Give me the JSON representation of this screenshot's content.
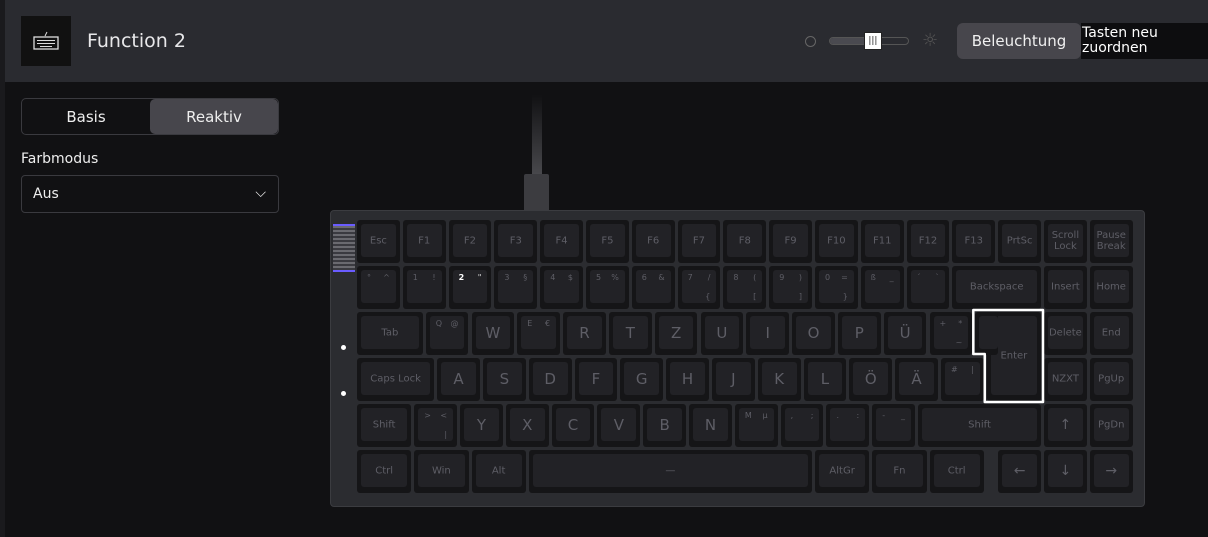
{
  "header": {
    "title": "Function 2",
    "brightness_percent": 55,
    "lighting_button": "Beleuchtung",
    "remap_button": "Tasten neu zuordnen"
  },
  "sidebar": {
    "tabs": [
      {
        "label": "Basis",
        "active": false
      },
      {
        "label": "Reaktiv",
        "active": true
      }
    ],
    "color_mode_label": "Farbmodus",
    "color_mode_value": "Aus"
  },
  "keyboard": {
    "selected_key": "Enter",
    "highlighted_key": "2",
    "rows": [
      [
        "Esc",
        "F1",
        "F2",
        "F3",
        "F4",
        "F5",
        "F6",
        "F7",
        "F8",
        "F9",
        "F10",
        "F11",
        "F12",
        "F13",
        "PrtSc",
        "Scroll Lock",
        "Pause Break"
      ],
      [
        [
          "°",
          "^",
          ""
        ],
        [
          "1",
          "!",
          ""
        ],
        [
          "2",
          "\"",
          ""
        ],
        [
          "3",
          "§",
          ""
        ],
        [
          "4",
          "$",
          ""
        ],
        [
          "5",
          "%",
          ""
        ],
        [
          "6",
          "&",
          ""
        ],
        [
          "7",
          "/",
          "{"
        ],
        [
          "8",
          "(",
          "["
        ],
        [
          "9",
          ")",
          "]"
        ],
        [
          "0",
          "=",
          "}"
        ],
        [
          "ß",
          "_",
          ""
        ],
        [
          "´",
          "`",
          ""
        ],
        "Backspace",
        "Insert",
        "Home"
      ],
      [
        "Tab",
        [
          "Q",
          "@",
          ""
        ],
        "W",
        [
          "E",
          "€",
          ""
        ],
        "R",
        "T",
        "Z",
        "U",
        "I",
        "O",
        "P",
        "Ü",
        [
          "+",
          "*",
          "~"
        ],
        "Enter",
        "Delete",
        "End"
      ],
      [
        "Caps Lock",
        "A",
        "S",
        "D",
        "F",
        "G",
        "H",
        "J",
        "K",
        "L",
        "Ö",
        "Ä",
        [
          "#",
          "|",
          ""
        ],
        "NZXT",
        "PgUp"
      ],
      [
        "Shift",
        [
          ">",
          "<",
          "|"
        ],
        "Y",
        "X",
        "C",
        "V",
        "B",
        "N",
        [
          "M",
          "µ",
          ""
        ],
        [
          ",",
          ";",
          ""
        ],
        [
          ".",
          ":",
          ""
        ],
        [
          "-",
          "_",
          ""
        ],
        "Shift",
        "↑",
        "PgDn"
      ],
      [
        "Ctrl",
        "Win",
        "Alt",
        "—",
        "AltGr",
        "Fn",
        "Ctrl",
        "←",
        "↓",
        "→"
      ]
    ]
  },
  "colors": {
    "accent": "#6a5cff",
    "selected_outline": "#ffffff",
    "background": "#111113",
    "header": "#2a2b30"
  }
}
